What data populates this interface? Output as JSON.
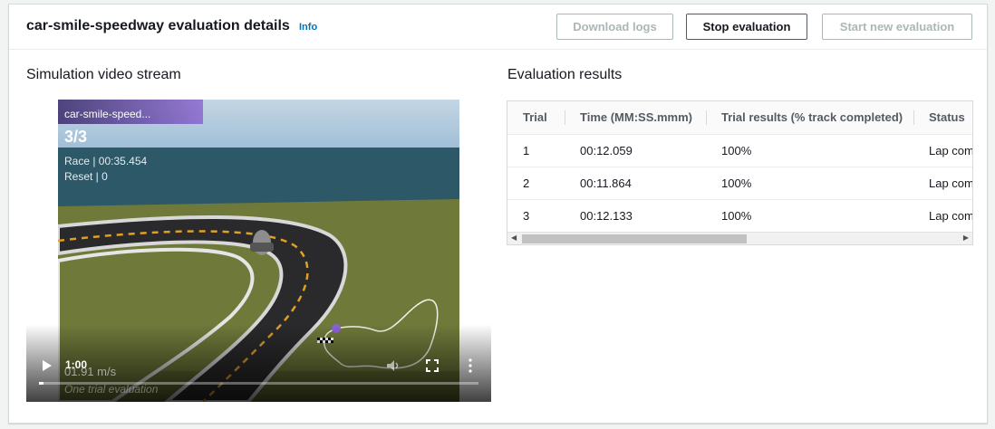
{
  "header": {
    "title": "car-smile-speedway evaluation details",
    "info": "Info",
    "buttons": {
      "download": "Download logs",
      "stop": "Stop evaluation",
      "start": "Start new evaluation"
    }
  },
  "video": {
    "section_title": "Simulation video stream",
    "overlay": {
      "model_name": "car-smile-speed...",
      "lap": "3/3",
      "race": "Race | 00:35.454",
      "reset": "Reset | 0"
    },
    "speed": "01.91 m/s",
    "trial_text": "One trial evaluation",
    "time": "1:00",
    "progress": 0.01
  },
  "results": {
    "section_title": "Evaluation results",
    "columns": [
      "Trial",
      "Time (MM:SS.mmm)",
      "Trial results (% track completed)",
      "Status"
    ],
    "rows": [
      [
        "1",
        "00:12.059",
        "100%",
        "Lap com"
      ],
      [
        "2",
        "00:11.864",
        "100%",
        "Lap com"
      ],
      [
        "3",
        "00:12.133",
        "100%",
        "Lap com"
      ]
    ]
  },
  "colors": {
    "accent": "#0073bb",
    "sky": "#aac7de",
    "sea": "#2c5868",
    "grass": "#6f7a3a",
    "track": "#2a2a2c"
  }
}
